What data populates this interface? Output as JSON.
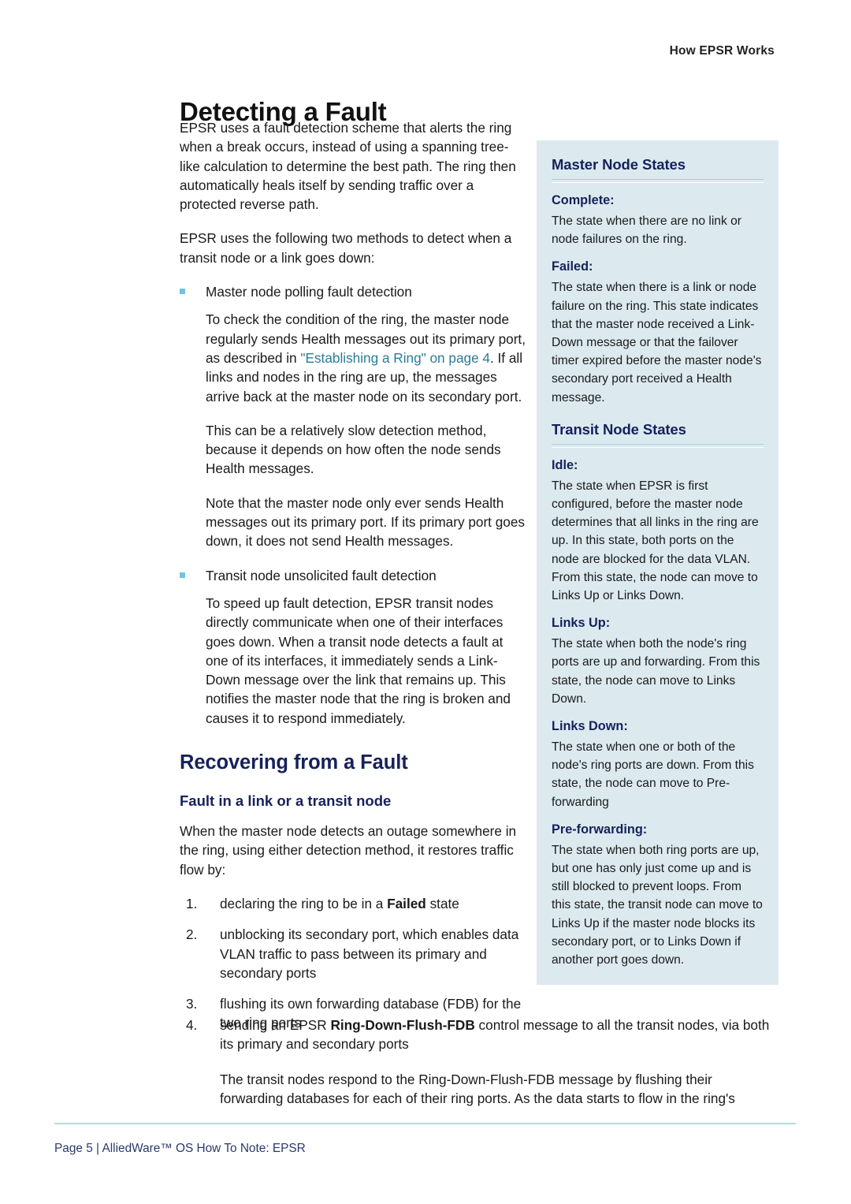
{
  "header": {
    "running_head": "How EPSR Works"
  },
  "title": "Detecting a Fault",
  "intro": {
    "para1": "EPSR uses a fault detection scheme that alerts the ring when a break occurs, instead of using a spanning tree-like calculation to determine the best path. The ring then automatically heals itself by sending traffic over a protected reverse path.",
    "para2": "EPSR uses the following two methods to detect when a transit node or a link goes down:"
  },
  "bullets": [
    {
      "label": "Master node polling fault detection",
      "paras": [
        {
          "pre": "To check the condition of the ring, the master node regularly sends Health messages out its primary port, as described in ",
          "link": "\"Establishing a Ring\" on page 4",
          "post": ". If all links and nodes in the ring are up, the messages arrive back at the master node on its secondary port."
        },
        {
          "pre": "This can be a relatively slow detection method, because it depends on how often the node sends Health messages."
        },
        {
          "pre": "Note that the master node only ever sends Health messages out its primary port. If its primary port goes down, it does not send Health messages."
        }
      ]
    },
    {
      "label": "Transit node unsolicited fault detection",
      "paras": [
        {
          "pre": "To speed up fault detection, EPSR transit nodes directly communicate when one of their interfaces goes down. When a transit node detects a fault at one of its interfaces, it immediately sends a Link-Down message over the link that remains up. This notifies the master node that the ring is broken and causes it to respond immediately."
        }
      ]
    }
  ],
  "recovering": {
    "heading": "Recovering from a Fault",
    "subheading": "Fault in a link or a transit node",
    "lead": "When the master node detects an outage somewhere in the ring, using either detection method, it restores traffic flow by:",
    "steps": [
      {
        "num": "1.",
        "pre": "declaring the ring to be in a ",
        "bold": "Failed",
        "post": " state"
      },
      {
        "num": "2.",
        "pre": "unblocking its secondary port, which enables data VLAN traffic to pass between its primary and secondary ports",
        "bold": "",
        "post": ""
      },
      {
        "num": "3.",
        "pre": "flushing its own forwarding database (FDB) for the two ring ports",
        "bold": "",
        "post": ""
      }
    ],
    "step4": {
      "num": "4.",
      "pre": "sending an EPSR ",
      "bold": "Ring-Down-Flush-FDB",
      "post": " control message to all the transit nodes, via both its primary and secondary ports"
    },
    "step4_follow": "The transit nodes respond to the Ring-Down-Flush-FDB message by flushing their forwarding databases for each of their ring ports. As the data starts to flow in the ring's"
  },
  "sidebar": {
    "master": {
      "title": "Master Node States",
      "terms": [
        {
          "term": "Complete:",
          "def": "The state when there are no link or node failures on the ring."
        },
        {
          "term": "Failed:",
          "def": "The state when there is a link or node failure on the ring. This state indicates that the master node received a Link-Down message or that the failover timer expired before the master node's secondary port received a Health message."
        }
      ]
    },
    "transit": {
      "title": "Transit Node States",
      "terms": [
        {
          "term": "Idle:",
          "def": "The state when EPSR is first configured, before the master node determines that all links in the ring are up. In this state, both ports on the node are blocked for the data VLAN. From this state, the node can move to Links Up or Links Down."
        },
        {
          "term": "Links Up:",
          "def": "The state when both the node's ring ports are up and forwarding. From this state, the node can move to Links Down."
        },
        {
          "term": "Links Down:",
          "def": "The state when one or both of the node's ring ports are down. From this state, the node can move to Pre-forwarding"
        },
        {
          "term": "Pre-forwarding:",
          "def": "The state when both ring ports are up, but one has only just come up and is still blocked to prevent loops. From this state, the transit node can move to Links Up if the master node blocks its secondary port, or to Links Down if another port goes down."
        }
      ]
    }
  },
  "footer": {
    "text": "Page 5 | AlliedWare™ OS How To Note: EPSR"
  },
  "colors": {
    "sidebar_bg": "#dceaf0",
    "heading_navy": "#16215b",
    "link_teal": "#2b7d96",
    "bullet_cyan": "#6ec6dd",
    "rule_teal": "#b2dbdd"
  }
}
